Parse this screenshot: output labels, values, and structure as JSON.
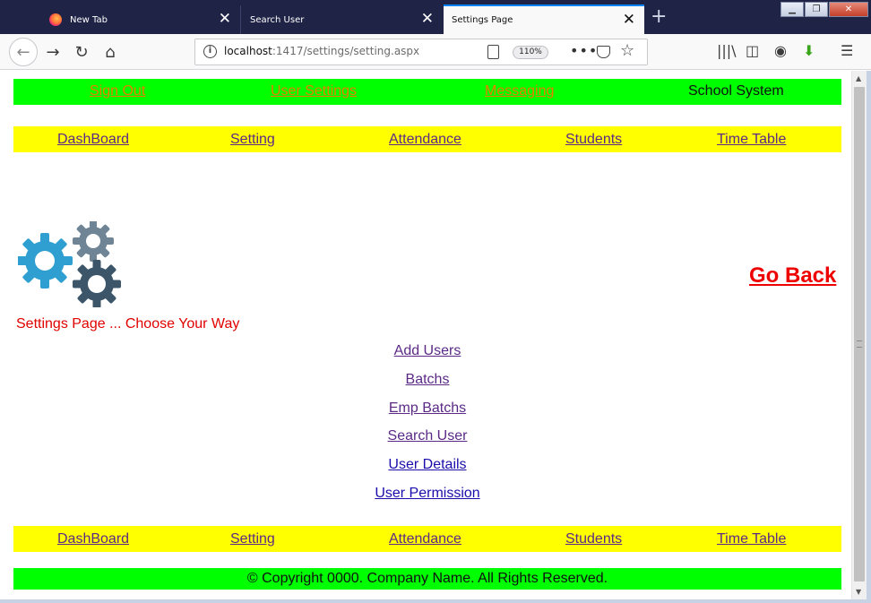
{
  "browser": {
    "tabs": [
      {
        "title": "New Tab"
      },
      {
        "title": "Search User"
      },
      {
        "title": "Settings Page"
      }
    ],
    "url_host": "localhost",
    "url_path": ":1417/settings/setting.aspx",
    "zoom": "110%"
  },
  "topnav": {
    "sign_out": "Sign Out",
    "user_settings": "User Settings",
    "messaging": "Messaging",
    "brand": "School System"
  },
  "menu": {
    "items": [
      "DashBoard",
      "Setting",
      "Attendance",
      "Students",
      "Time Table"
    ]
  },
  "main": {
    "go_back": "Go Back",
    "tagline": "Settings Page ... Choose Your Way",
    "links": [
      "Add Users",
      "Batchs",
      "Emp Batchs",
      "Search User",
      "User Details",
      "User Permission"
    ]
  },
  "footer": {
    "copyright": "© Copyright 0000. Company Name. All Rights Reserved."
  },
  "colors": {
    "green_bar": "#00ff00",
    "yellow_bar": "#ffff00",
    "link_visited": "#5b2a86",
    "link_unvisited": "#1a0dab",
    "go_back": "#ee0000"
  }
}
